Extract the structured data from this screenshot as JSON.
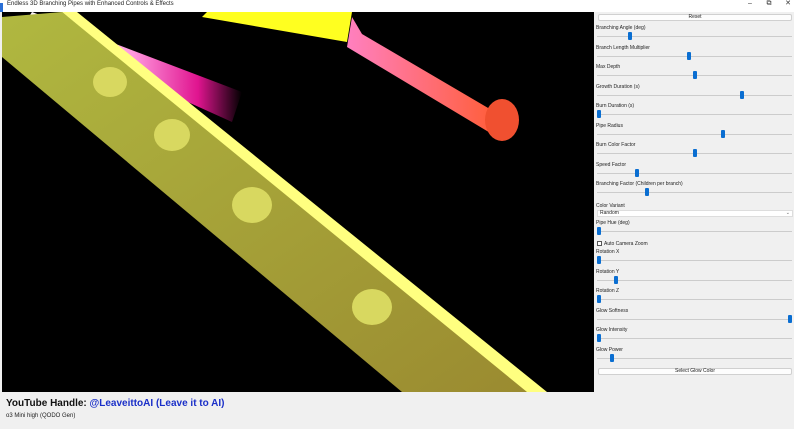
{
  "window": {
    "title": "Endless 3D Branching Pipes with Enhanced Controls & Effects",
    "minimize": "–",
    "maximize": "⧉",
    "close": "✕"
  },
  "panel": {
    "reset_label": "Reset",
    "sliders": [
      {
        "label": "Branching Angle (deg)",
        "value": 0.16
      },
      {
        "label": "Branch Length Multiplier",
        "value": 0.47
      },
      {
        "label": "Max Depth",
        "value": 0.5
      },
      {
        "label": "Growth Duration (s)",
        "value": 0.75
      },
      {
        "label": "Burn Duration (s)",
        "value": 0.0
      },
      {
        "label": "Pipe Radius",
        "value": 0.65
      },
      {
        "label": "Burn Color Factor",
        "value": 0.5
      },
      {
        "label": "Speed Factor",
        "value": 0.2
      },
      {
        "label": "Branching Factor (Children per branch)",
        "value": 0.25
      }
    ],
    "color_variant_label": "Color Variant",
    "color_variant_value": "Random",
    "sliders2": [
      {
        "label": "Pipe Hue (deg)",
        "value": 0.0
      }
    ],
    "auto_zoom_label": "Auto Camera Zoom",
    "auto_zoom_checked": false,
    "sliders3": [
      {
        "label": "Rotation X",
        "value": 0.0
      },
      {
        "label": "Rotation Y",
        "value": 0.09
      },
      {
        "label": "Rotation Z",
        "value": 0.0
      },
      {
        "label": "Glow Softness",
        "value": 1.0
      },
      {
        "label": "Glow Intensity",
        "value": 0.0
      },
      {
        "label": "Glow Power",
        "value": 0.07
      }
    ],
    "glow_button_label": "Select Glow Color",
    "accent": "#0a6ed1"
  },
  "footer": {
    "prefix": "YouTube Handle: ",
    "handle": "@LeaveittoAI (Leave it to AI)",
    "subtitle": "o3 Mini high (QODO Gen)"
  }
}
